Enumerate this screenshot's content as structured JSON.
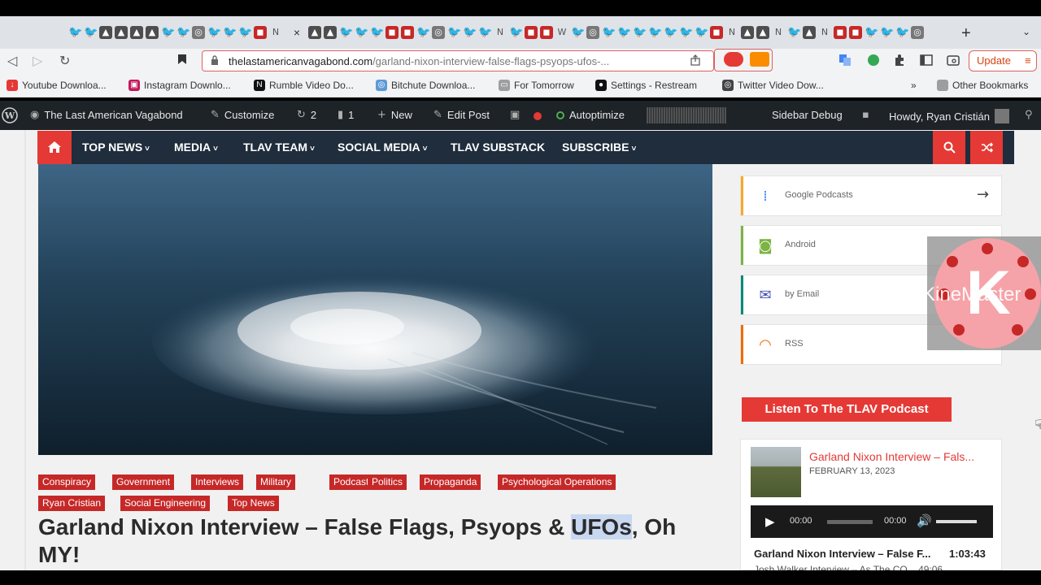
{
  "browser": {
    "tab_close": "×",
    "new_tab": "+",
    "tab_menu": "⌄",
    "url_domain": "thelastamericanvagabond.com",
    "url_path": "/garland-nixon-interview-false-flags-psyops-ufos-...",
    "update_label": "Update",
    "update_menu": "⋮",
    "nav": {
      "back": "◁",
      "forward": "▷",
      "reload": "↻",
      "bookmark": "🔖"
    },
    "tab_glyphs": [
      {
        "g": "🐦",
        "c": "tw"
      },
      {
        "g": "🐦",
        "c": "tw"
      },
      {
        "g": "▲",
        "c": "dk"
      },
      {
        "g": "▲",
        "c": "dk"
      },
      {
        "g": "▲",
        "c": "dk"
      },
      {
        "g": "▲",
        "c": "dk"
      },
      {
        "g": "🐦",
        "c": "tw"
      },
      {
        "g": "🐦",
        "c": "tw"
      },
      {
        "g": "◎",
        "c": "gr"
      },
      {
        "g": "🐦",
        "c": "tw"
      },
      {
        "g": "🐦",
        "c": "tw"
      },
      {
        "g": "🐦",
        "c": "tw"
      },
      {
        "g": "◼",
        "c": "rd"
      },
      {
        "g": "N",
        "c": "nn"
      }
    ],
    "tab_glyphs_right": [
      {
        "g": "▲",
        "c": "dk"
      },
      {
        "g": "▲",
        "c": "dk"
      },
      {
        "g": "🐦",
        "c": "tw"
      },
      {
        "g": "🐦",
        "c": "tw"
      },
      {
        "g": "🐦",
        "c": "tw"
      },
      {
        "g": "◼",
        "c": "rd"
      },
      {
        "g": "◼",
        "c": "rd"
      },
      {
        "g": "🐦",
        "c": "tw"
      },
      {
        "g": "◎",
        "c": "gr"
      },
      {
        "g": "🐦",
        "c": "tw"
      },
      {
        "g": "🐦",
        "c": "tw"
      },
      {
        "g": "🐦",
        "c": "tw"
      },
      {
        "g": "N",
        "c": "nn"
      },
      {
        "g": "🐦",
        "c": "tw"
      },
      {
        "g": "◼",
        "c": "rd"
      },
      {
        "g": "◼",
        "c": "rd"
      },
      {
        "g": "W",
        "c": "nn"
      },
      {
        "g": "🐦",
        "c": "tw"
      },
      {
        "g": "◎",
        "c": "gr"
      },
      {
        "g": "🐦",
        "c": "tw"
      },
      {
        "g": "🐦",
        "c": "tw"
      },
      {
        "g": "🐦",
        "c": "tw"
      },
      {
        "g": "🐦",
        "c": "tw"
      },
      {
        "g": "🐦",
        "c": "tw"
      },
      {
        "g": "🐦",
        "c": "tw"
      },
      {
        "g": "🐦",
        "c": "tw"
      },
      {
        "g": "◼",
        "c": "rd"
      },
      {
        "g": "N",
        "c": "nn"
      },
      {
        "g": "▲",
        "c": "dk"
      },
      {
        "g": "▲",
        "c": "dk"
      },
      {
        "g": "N",
        "c": "nn"
      },
      {
        "g": "🐦",
        "c": "tw"
      },
      {
        "g": "▲",
        "c": "dk"
      },
      {
        "g": "N",
        "c": "nn"
      },
      {
        "g": "◼",
        "c": "rd"
      },
      {
        "g": "◼",
        "c": "rd"
      },
      {
        "g": "🐦",
        "c": "tw"
      },
      {
        "g": "🐦",
        "c": "tw"
      },
      {
        "g": "🐦",
        "c": "tw"
      },
      {
        "g": "◎",
        "c": "gr"
      }
    ]
  },
  "bookmarks": {
    "items": [
      {
        "label": "Youtube Downloa...",
        "icon": "↓",
        "color": "#e53935"
      },
      {
        "label": "Instagram Downlo...",
        "icon": "▣",
        "color": "#c2185b"
      },
      {
        "label": "Rumble Video Do...",
        "icon": "N",
        "color": "#111111"
      },
      {
        "label": "Bitchute Downloa...",
        "icon": "◎",
        "color": "#5c9ad6"
      },
      {
        "label": "For Tomorrow",
        "icon": "▭",
        "color": "#9e9e9e"
      },
      {
        "label": "Settings - Restream",
        "icon": "●",
        "color": "#111111"
      },
      {
        "label": "Twitter Video Dow...",
        "icon": "◎",
        "color": "#444444"
      }
    ],
    "overflow": "»",
    "other": "Other Bookmarks"
  },
  "wpbar": {
    "wp_logo": "W",
    "site_name": "The Last American Vagabond",
    "customize": "Customize",
    "updates_count": "2",
    "comments_count": "1",
    "new_label": "New",
    "edit_post": "Edit Post",
    "autoptimize": "Autoptimize",
    "sidebar_debug": "Sidebar Debug",
    "howdy": "Howdy, Ryan Cristián"
  },
  "sitenav": {
    "items": [
      "TOP NEWS",
      "MEDIA",
      "TLAV TEAM",
      "SOCIAL MEDIA",
      "TLAV SUBSTACK",
      "SUBSCRIBE"
    ],
    "dropdown_marker": "˅",
    "home_icon": "⌂",
    "search_icon": "⚲",
    "shuffle_icon": "⤨"
  },
  "post": {
    "categories": [
      "Conspiracy",
      "Government",
      "Interviews",
      "Military",
      "Podcast",
      "Politics",
      "Propaganda",
      "Psychological Operations",
      "Ryan Cristian",
      "Social Engineering",
      "Top News"
    ],
    "title_part1": "Garland Nixon Interview – False Flags, Psyops & ",
    "title_highlight": "UFOs",
    "title_part2": ", Oh MY!"
  },
  "sidebar": {
    "subscribe": [
      {
        "label": "Google Podcasts",
        "icon": "⁞",
        "bar": "#f9a825",
        "color": "#4285f4"
      },
      {
        "label": "Android",
        "icon": "◙",
        "bar": "#7cb342",
        "color": "#7cb342"
      },
      {
        "label": "by Email",
        "icon": "✉",
        "bar": "#00897b",
        "color": "#3f51b5"
      },
      {
        "label": "RSS",
        "icon": "◠",
        "bar": "#ef6c00",
        "color": "#ef6c00"
      }
    ],
    "arrow": "→",
    "listen_label": "Listen To The TLAV Podcast",
    "podcast": {
      "title": "Garland Nixon Interview – Fals...",
      "date": "FEBRUARY 13, 2023",
      "time_current": "00:00",
      "time_total": "00:00",
      "track_title": "Garland Nixon Interview – False F...",
      "track_duration": "1:03:43",
      "next_track": "Josh Walker Interview – As The CO... 49:06"
    }
  },
  "watermark": {
    "letter": "K",
    "text": "KineMaster"
  },
  "cursor": "☟"
}
